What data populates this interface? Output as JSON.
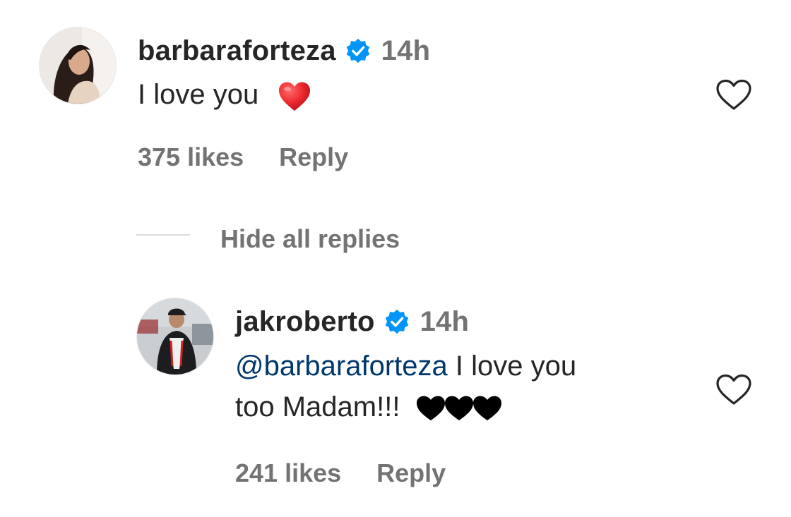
{
  "comments": [
    {
      "username": "barbaraforteza",
      "verified": true,
      "time": "14h",
      "text": "I love you",
      "emoji": "red-heart",
      "likes": "375 likes",
      "reply_label": "Reply"
    }
  ],
  "replies_toggle": "Hide all replies",
  "replies": [
    {
      "username": "jakroberto",
      "verified": true,
      "time": "14h",
      "mention": "@barbaraforteza",
      "text_line1": " I love you",
      "text_line2": "too Madam!!!",
      "emoji": "black-heart x3",
      "likes": "241 likes",
      "reply_label": "Reply"
    }
  ],
  "colors": {
    "verified_blue": "#0095f6",
    "mention_blue": "#00376b",
    "secondary_text": "#737373",
    "heart_red": "#e8262b"
  }
}
